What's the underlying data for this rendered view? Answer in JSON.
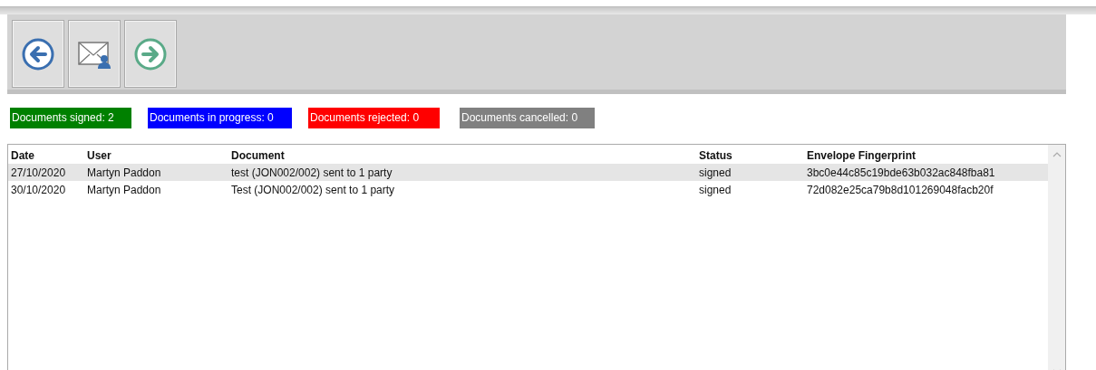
{
  "toolbar": [
    {
      "kind": "back"
    },
    {
      "kind": "mail"
    },
    {
      "kind": "forward"
    }
  ],
  "counters": [
    {
      "label": "Documents signed: 2",
      "color": "#008000"
    },
    {
      "label": "Documents in progress: 0",
      "color": "#0000ff"
    },
    {
      "label": "Documents rejected: 0",
      "color": "#ff0000"
    },
    {
      "label": "Documents cancelled: 0",
      "color": "#808080"
    }
  ],
  "table": {
    "columns": [
      "Date",
      "User",
      "Document",
      "Status",
      "Envelope Fingerprint"
    ],
    "rows": [
      {
        "cells": [
          "27/10/2020",
          "Martyn Paddon",
          "test (JON002/002) sent to 1 party",
          "signed",
          "3bc0e44c85c19bde63b032ac848fba81"
        ],
        "selected": true
      },
      {
        "cells": [
          "30/10/2020",
          "Martyn Paddon",
          "Test (JON002/002) sent to 1 party",
          "signed",
          "72d082e25ca79b8d101269048facb20f"
        ],
        "selected": false
      }
    ]
  }
}
